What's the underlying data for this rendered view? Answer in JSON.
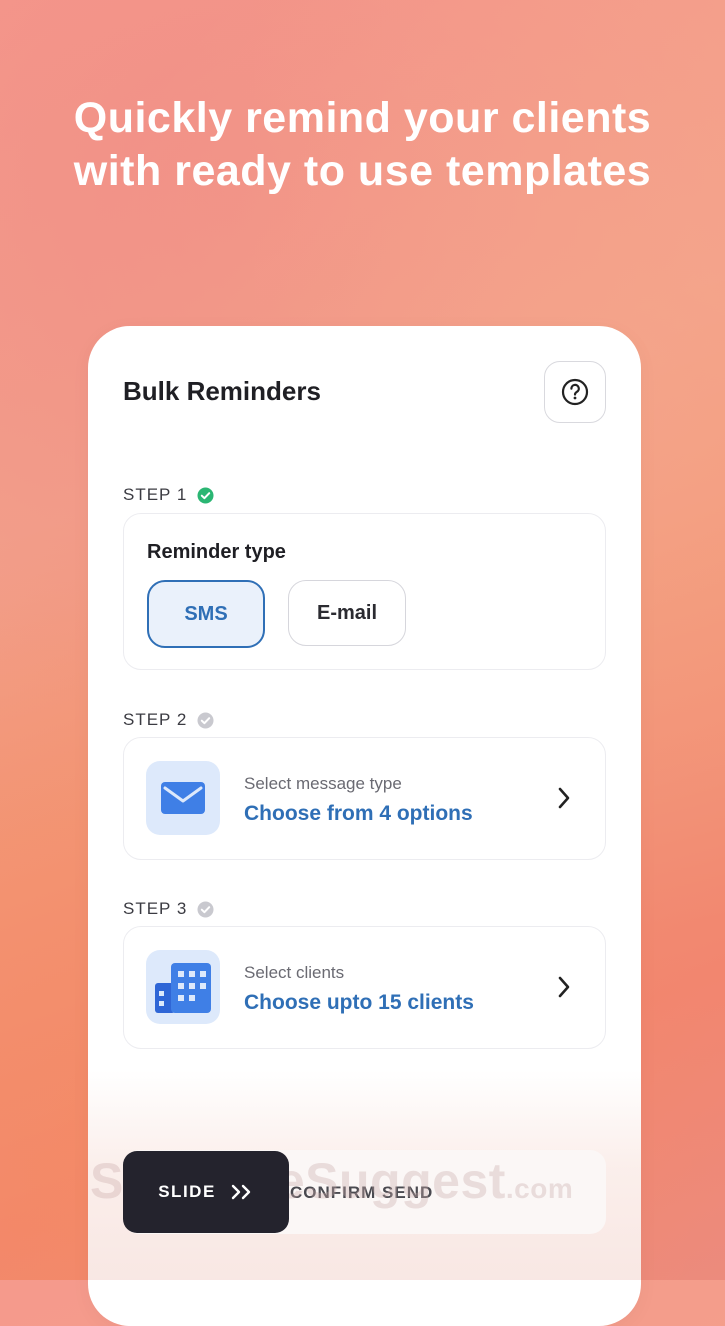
{
  "headline": {
    "line1": "Quickly remind your clients",
    "line2": "with ready to use templates"
  },
  "card": {
    "title": "Bulk Reminders",
    "help_icon": "question-circle-icon"
  },
  "step1": {
    "label": "STEP 1",
    "status": "completed",
    "status_color": "#2bb673",
    "panel_title": "Reminder type",
    "options": [
      {
        "label": "SMS",
        "selected": true
      },
      {
        "label": "E-mail",
        "selected": false
      }
    ]
  },
  "step2": {
    "label": "STEP 2",
    "status": "pending",
    "icon": "envelope-icon",
    "subtitle": "Select message type",
    "action": "Choose from 4 options"
  },
  "step3": {
    "label": "STEP 3",
    "status": "pending",
    "icon": "building-icon",
    "subtitle": "Select clients",
    "action": "Choose upto 15 clients"
  },
  "slider": {
    "knob_label": "SLIDE",
    "knob_icon": "double-chevron-right-icon",
    "track_label": "CONFIRM SEND"
  },
  "watermark": {
    "text": "SoftwareSuggest",
    "suffix": ".com"
  },
  "colors": {
    "accent": "#2f6fb6",
    "knob": "#24232d",
    "success": "#2bb673"
  }
}
